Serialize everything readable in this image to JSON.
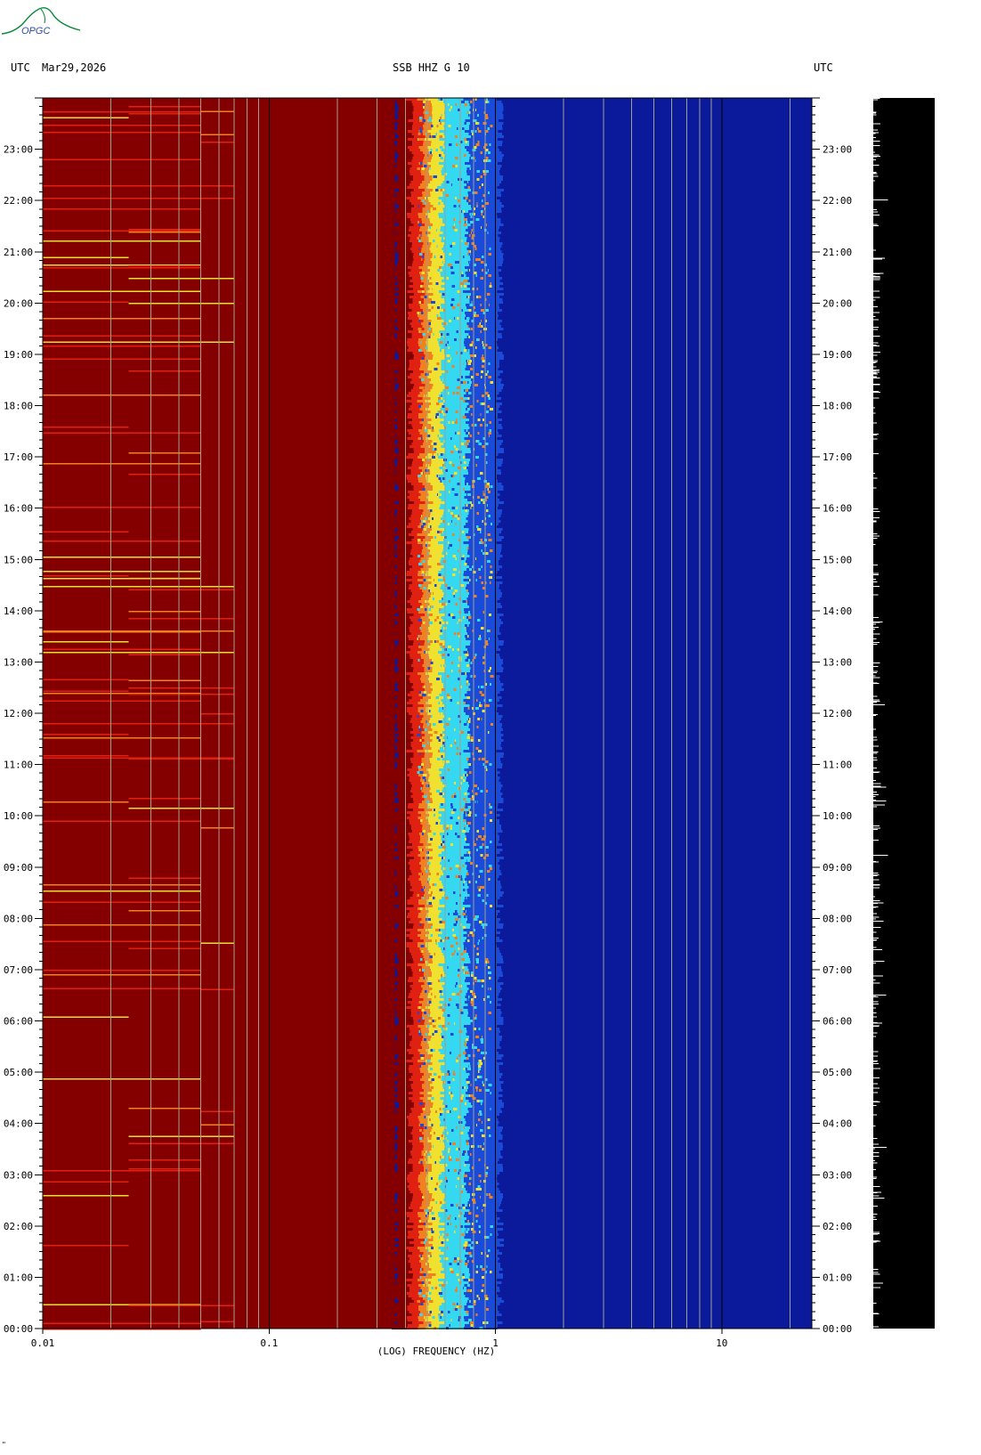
{
  "header": {
    "left_tz": "UTC",
    "date": "Mar29,2026",
    "station": "SSB HHZ G 10",
    "right_tz": "UTC"
  },
  "logo": {
    "text": "OPGC",
    "color": "#0a8a3a",
    "text_color": "#2a4da8"
  },
  "colors": {
    "low": "#0a1a9a",
    "mid_blue": "#1a4ad8",
    "cyan": "#34d8f0",
    "yellow": "#f0e030",
    "orange": "#f08020",
    "red": "#e02010",
    "high": "#840000",
    "trace": "#000000",
    "gridline": "#a0a090"
  },
  "footer_mark": "\"",
  "chart_data": {
    "type": "heatmap",
    "title": "SSB HHZ G 10",
    "xlabel": "(LOG) FREQUENCY (HZ)",
    "x_scale": "log",
    "xlim": [
      0.01,
      25
    ],
    "x_ticks": [
      "0.01",
      "0.1",
      "1",
      "10"
    ],
    "x_tick_values": [
      0.01,
      0.1,
      1,
      10
    ],
    "ylim": [
      0,
      24
    ],
    "y_ticks": [
      "00:00",
      "01:00",
      "02:00",
      "03:00",
      "04:00",
      "05:00",
      "06:00",
      "07:00",
      "08:00",
      "09:00",
      "10:00",
      "11:00",
      "12:00",
      "13:00",
      "14:00",
      "15:00",
      "16:00",
      "17:00",
      "18:00",
      "19:00",
      "20:00",
      "21:00",
      "22:00",
      "23:00"
    ],
    "bands": [
      {
        "from": 0.01,
        "to": 0.35,
        "level": "high"
      },
      {
        "from": 0.35,
        "to": 0.45,
        "level": "red-orange"
      },
      {
        "from": 0.45,
        "to": 0.55,
        "level": "yellow"
      },
      {
        "from": 0.55,
        "to": 0.75,
        "level": "cyan"
      },
      {
        "from": 0.75,
        "to": 1.0,
        "level": "mid-blue"
      },
      {
        "from": 1.0,
        "to": 25,
        "level": "low"
      }
    ],
    "vertical_gridlines_hz": [
      0.02,
      0.03,
      0.04,
      0.05,
      0.06,
      0.07,
      0.08,
      0.09,
      0.2,
      0.3,
      0.4,
      0.5,
      0.6,
      0.7,
      0.8,
      0.9,
      2,
      3,
      4,
      5,
      6,
      7,
      8,
      9,
      20
    ],
    "grid": true,
    "legend": "none"
  }
}
